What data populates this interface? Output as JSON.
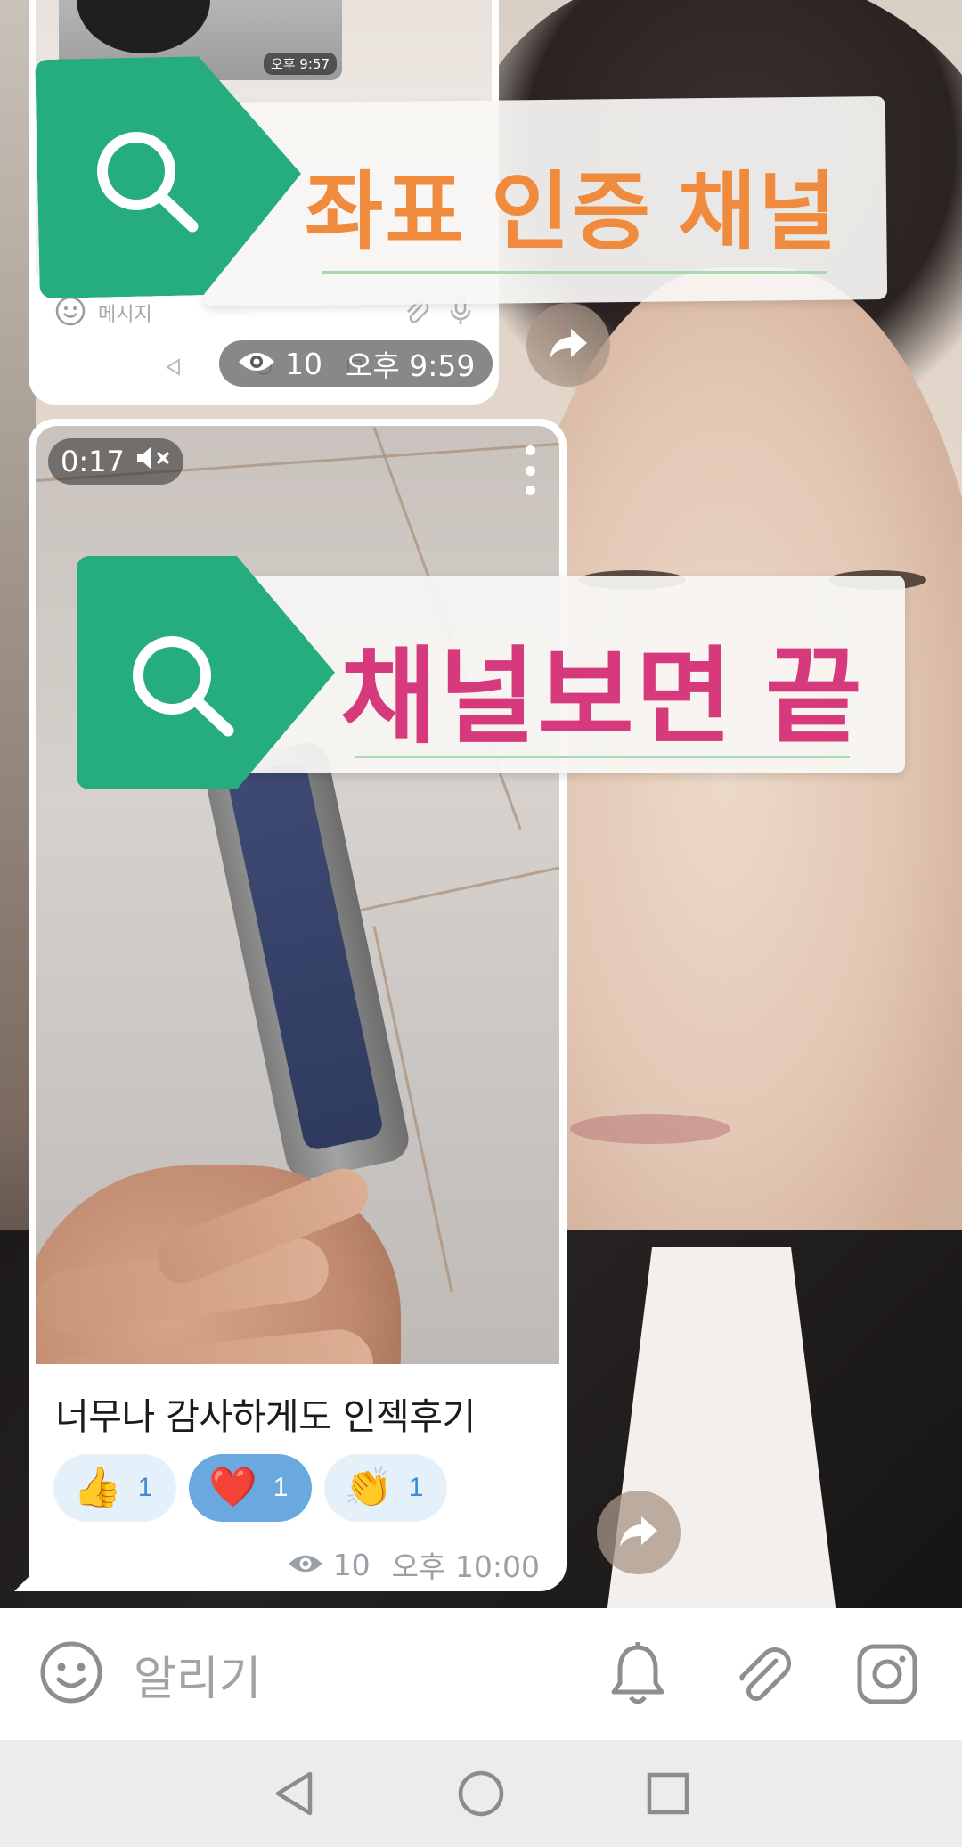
{
  "top_message": {
    "thumb_time": "오후 9:57",
    "inner_input_placeholder": "메시지",
    "views": "10",
    "time": "오후 9:59"
  },
  "banners": [
    {
      "text": "좌표 인증 채널",
      "color": "#f08a3c"
    },
    {
      "text": "채널보면 끝",
      "color": "#d63a7c"
    }
  ],
  "video_message": {
    "duration": "0:17",
    "caption": "너무나 감사하게도 인젝후기",
    "reactions": [
      {
        "emoji": "👍",
        "count": "1",
        "active": false
      },
      {
        "emoji": "❤️",
        "count": "1",
        "active": true
      },
      {
        "emoji": "👏",
        "count": "1",
        "active": false
      }
    ],
    "views": "10",
    "time": "오후 10:00"
  },
  "input_bar": {
    "placeholder": "알리기"
  },
  "icons": {
    "emoji": "smile-icon",
    "bell": "bell-icon",
    "attach": "paperclip-icon",
    "camera": "instagram-style-camera-icon",
    "share": "share-arrow-icon",
    "search": "magnifier-icon",
    "eye": "eye-icon",
    "mute": "mute-icon"
  },
  "colors": {
    "tag_green": "#25ad7e",
    "reaction_bg": "#e4f0fa",
    "reaction_active_bg": "#6aa9df",
    "meta_gray": "#9aa0a6"
  }
}
